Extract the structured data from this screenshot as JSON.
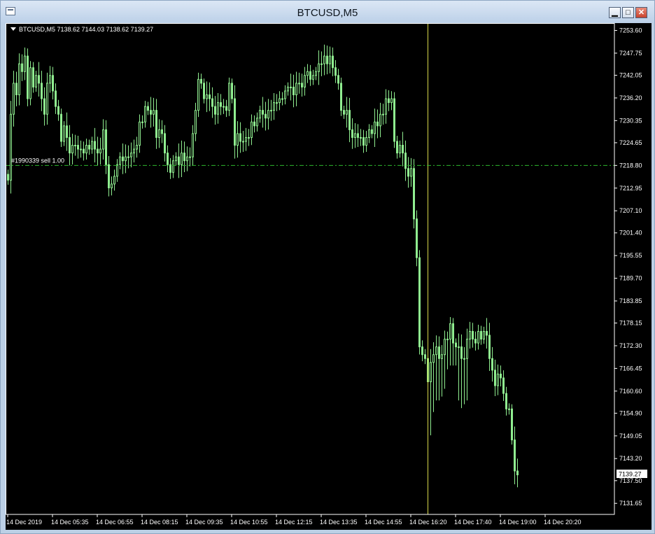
{
  "window": {
    "title": "BTCUSD,M5",
    "min_label": "▁",
    "max_label": "□",
    "close_label": "✕"
  },
  "chart_data": {
    "type": "candlestick",
    "symbol_info": "BTCUSD,M5  7138.62 7144.03 7138.62 7139.27",
    "order_line": {
      "label": "#1990339 sell 1.00",
      "price": 7218.8
    },
    "current_price": "7139.27",
    "vertical_line_time_index": 150,
    "ylim": [
      7128.8,
      7255.5
    ],
    "y_ticks": [
      "7253.60",
      "7247.75",
      "7242.05",
      "7236.20",
      "7230.35",
      "7224.65",
      "7218.80",
      "7212.95",
      "7207.10",
      "7201.40",
      "7195.55",
      "7189.70",
      "7183.85",
      "7178.15",
      "7172.30",
      "7166.45",
      "7160.60",
      "7154.90",
      "7149.05",
      "7143.20",
      "7137.50",
      "7131.65"
    ],
    "x_ticks": [
      {
        "index": 0,
        "label": "14 Dec 2019"
      },
      {
        "index": 16,
        "label": "14 Dec 05:35"
      },
      {
        "index": 32,
        "label": "14 Dec 06:55"
      },
      {
        "index": 48,
        "label": "14 Dec 08:15"
      },
      {
        "index": 64,
        "label": "14 Dec 09:35"
      },
      {
        "index": 80,
        "label": "14 Dec 10:55"
      },
      {
        "index": 96,
        "label": "14 Dec 12:15"
      },
      {
        "index": 112,
        "label": "14 Dec 13:35"
      },
      {
        "index": 128,
        "label": "14 Dec 14:55"
      },
      {
        "index": 144,
        "label": "14 Dec 16:20"
      },
      {
        "index": 160,
        "label": "14 Dec 17:40"
      },
      {
        "index": 176,
        "label": "14 Dec 19:00"
      },
      {
        "index": 192,
        "label": "14 Dec 20:20"
      }
    ],
    "close_series": [
      7215,
      7232,
      7240,
      7237,
      7245,
      7243,
      7247,
      7236,
      7244,
      7239,
      7242,
      7240,
      7236,
      7232,
      7240,
      7242,
      7238,
      7234,
      7232,
      7225,
      7229,
      7226,
      7222,
      7224,
      7224,
      7223,
      7223,
      7222,
      7224,
      7223,
      7225,
      7223,
      7222,
      7223,
      7228,
      7219,
      7213,
      7214,
      7216,
      7219,
      7221,
      7220,
      7221,
      7221,
      7222,
      7223,
      7224,
      7230,
      7230,
      7234,
      7233,
      7232,
      7233,
      7226,
      7228,
      7227,
      7222,
      7219,
      7217,
      7220,
      7221,
      7219,
      7222,
      7220,
      7221,
      7221,
      7227,
      7233,
      7241,
      7240,
      7236,
      7237,
      7236,
      7234,
      7232,
      7235,
      7234,
      7234,
      7233,
      7240,
      7236,
      7224,
      7227,
      7225,
      7225,
      7226,
      7226,
      7230,
      7229,
      7231,
      7233,
      7232,
      7231,
      7233,
      7233,
      7235,
      7235,
      7236,
      7236,
      7238,
      7239,
      7239,
      7237,
      7240,
      7240,
      7239,
      7242,
      7243,
      7241,
      7242,
      7243,
      7245,
      7245,
      7247,
      7245,
      7247,
      7244,
      7242,
      7240,
      7233,
      7232,
      7233,
      7228,
      7226,
      7227,
      7226,
      7226,
      7224,
      7226,
      7228,
      7227,
      7230,
      7229,
      7232,
      7232,
      7236,
      7235,
      7236,
      7225,
      7222,
      7224,
      7222,
      7218,
      7216,
      7218,
      7205,
      7195,
      7172,
      7170,
      7169,
      7163,
      7168,
      7170,
      7172,
      7169,
      7170,
      7174,
      7174,
      7178,
      7173,
      7172,
      7172,
      7169,
      7169,
      7174,
      7176,
      7174,
      7173,
      7176,
      7174,
      7176,
      7175,
      7169,
      7166,
      7162,
      7165,
      7164,
      7160,
      7156,
      7156,
      7148,
      7140,
      7139
    ]
  }
}
